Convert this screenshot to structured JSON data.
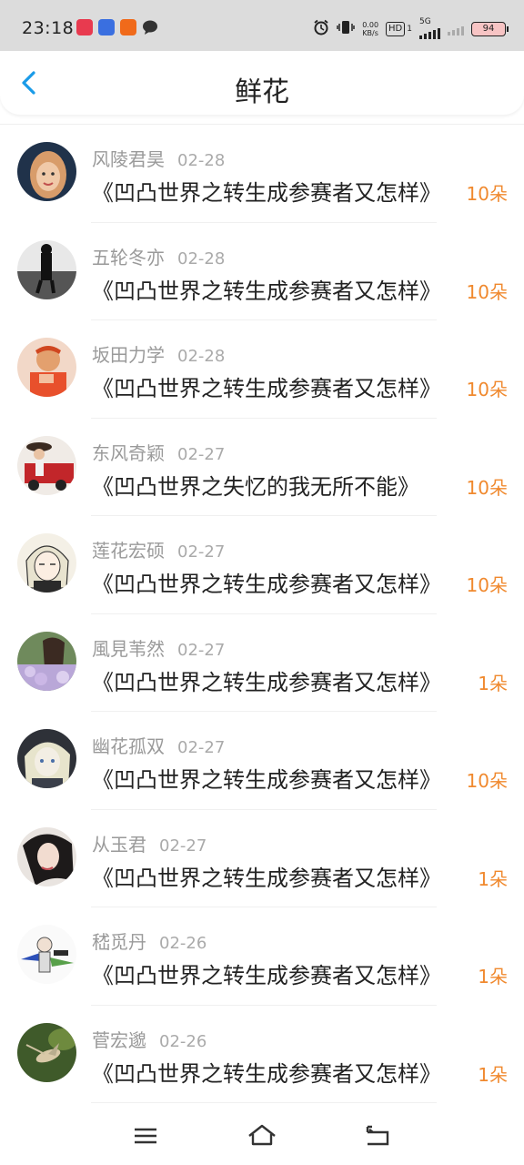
{
  "status_bar": {
    "time": "23:18",
    "net_speed_value": "0.00",
    "net_speed_unit": "KB/s",
    "hd_label": "HD",
    "hd_sub": "1",
    "network_label": "5G",
    "battery": "94"
  },
  "header": {
    "title": "鲜花"
  },
  "entries": [
    {
      "user": "风陵君昊",
      "date": "02-28",
      "book": "《凹凸世界之转生成参赛者又怎样》",
      "amount": "10朵"
    },
    {
      "user": "五轮冬亦",
      "date": "02-28",
      "book": "《凹凸世界之转生成参赛者又怎样》",
      "amount": "10朵"
    },
    {
      "user": "坂田力学",
      "date": "02-28",
      "book": "《凹凸世界之转生成参赛者又怎样》",
      "amount": "10朵"
    },
    {
      "user": "东风奇颖",
      "date": "02-27",
      "book": "《凹凸世界之失忆的我无所不能》",
      "amount": "10朵"
    },
    {
      "user": "莲花宏硕",
      "date": "02-27",
      "book": "《凹凸世界之转生成参赛者又怎样》",
      "amount": "10朵"
    },
    {
      "user": "風見苇然",
      "date": "02-27",
      "book": "《凹凸世界之转生成参赛者又怎样》",
      "amount": "1朵"
    },
    {
      "user": "幽花孤双",
      "date": "02-27",
      "book": "《凹凸世界之转生成参赛者又怎样》",
      "amount": "10朵"
    },
    {
      "user": "从玉君",
      "date": "02-27",
      "book": "《凹凸世界之转生成参赛者又怎样》",
      "amount": "1朵"
    },
    {
      "user": "嵇觅丹",
      "date": "02-26",
      "book": "《凹凸世界之转生成参赛者又怎样》",
      "amount": "1朵"
    },
    {
      "user": "菅宏邈",
      "date": "02-26",
      "book": "《凹凸世界之转生成参赛者又怎样》",
      "amount": "1朵"
    }
  ],
  "colors": {
    "accent_blue": "#1a9be8",
    "amount_orange": "#f0892e"
  }
}
